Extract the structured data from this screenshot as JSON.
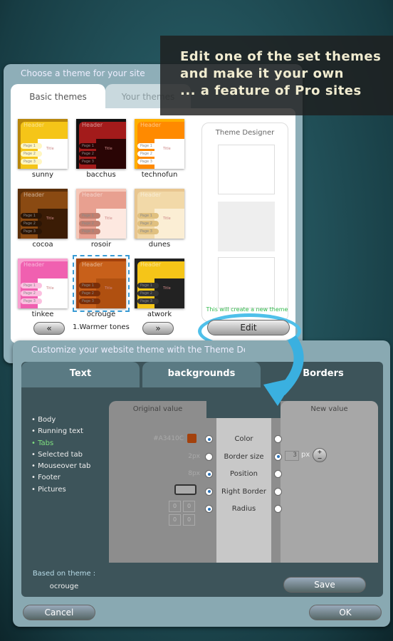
{
  "caption": {
    "line1": "Edit one of the set themes",
    "line2": "and make it your own",
    "line3": "... a feature of Pro sites"
  },
  "chooser": {
    "title": "Choose a theme for your site",
    "tabs": [
      "Basic themes",
      "Your themes"
    ],
    "themes": [
      {
        "name": "sunny",
        "bg": "#f5c518",
        "frame": "#b8860b",
        "box": "#ffffff",
        "pg": "#fff6c0"
      },
      {
        "name": "bacchus",
        "bg": "#a31b1b",
        "frame": "#111",
        "box": "#2a0505",
        "pg": "#2a0505"
      },
      {
        "name": "technofun",
        "bg": "#ff8a00",
        "frame": "#ffb000",
        "box": "#ffffff",
        "pg": "#fff"
      },
      {
        "name": "cocoa",
        "bg": "#8a4a12",
        "frame": "#5a2e08",
        "box": "#3b1c05",
        "pg": "#2b1505"
      },
      {
        "name": "rosoir",
        "bg": "#e8a090",
        "frame": "#f5c7b8",
        "box": "#fde8e0",
        "pg": "#c08070"
      },
      {
        "name": "dunes",
        "bg": "#f2d9a8",
        "frame": "#e8c690",
        "box": "#fbeed4",
        "pg": "#e0c080"
      },
      {
        "name": "tinkee",
        "bg": "#f060b0",
        "frame": "#f8a0d0",
        "box": "#ffffff",
        "pg": "#fbc0e0"
      },
      {
        "name": "ocrouge",
        "bg": "#c8601a",
        "frame": "#a3410c",
        "box": "#b05010",
        "pg": "#7a2e08"
      },
      {
        "name": "atwork",
        "bg": "#f5c518",
        "frame": "#222",
        "box": "#222",
        "pg": "#333"
      }
    ],
    "page_labels": [
      "Page 1",
      "Page 2",
      "Page 3"
    ],
    "header_label": "Header",
    "title_label": "Title",
    "category": "1.Warmer tones",
    "prev": "«",
    "next": "»",
    "designer": {
      "title": "Theme Designer",
      "hint": "This will create a new theme",
      "edit": "Edit"
    }
  },
  "customize": {
    "title": "Customize your website theme with the Theme Designer",
    "tabs": [
      "Text",
      "backgrounds",
      "Borders"
    ],
    "elements": [
      "Body",
      "Running text",
      "Tabs",
      "Selected tab",
      "Mouseover tab",
      "Footer",
      "Pictures"
    ],
    "active_element": "Tabs",
    "original_header": "Original value",
    "new_header": "New value",
    "rows": [
      {
        "label": "Color",
        "original": "#A3410C",
        "orig_on": true,
        "new_on": false
      },
      {
        "label": "Border size",
        "original": "2px",
        "orig_on": false,
        "new_on": true
      },
      {
        "label": "Position",
        "original": "8px",
        "orig_on": true,
        "new_on": false
      },
      {
        "label": "Right Border",
        "original": "",
        "orig_on": true,
        "new_on": false
      },
      {
        "label": "Radius",
        "original": "",
        "orig_on": true,
        "new_on": false
      }
    ],
    "radius_values": [
      "0",
      "0",
      "0",
      "0"
    ],
    "border_size_new": "3",
    "unit": "px",
    "based_on_label": "Based on theme :",
    "based_on": "ocrouge",
    "save": "Save",
    "cancel": "Cancel",
    "ok": "OK"
  },
  "colors": {
    "accent": "#3ab0e0",
    "swatch": "#A3410C",
    "active": "#7fe07f",
    "hint": "#2fb84a"
  }
}
